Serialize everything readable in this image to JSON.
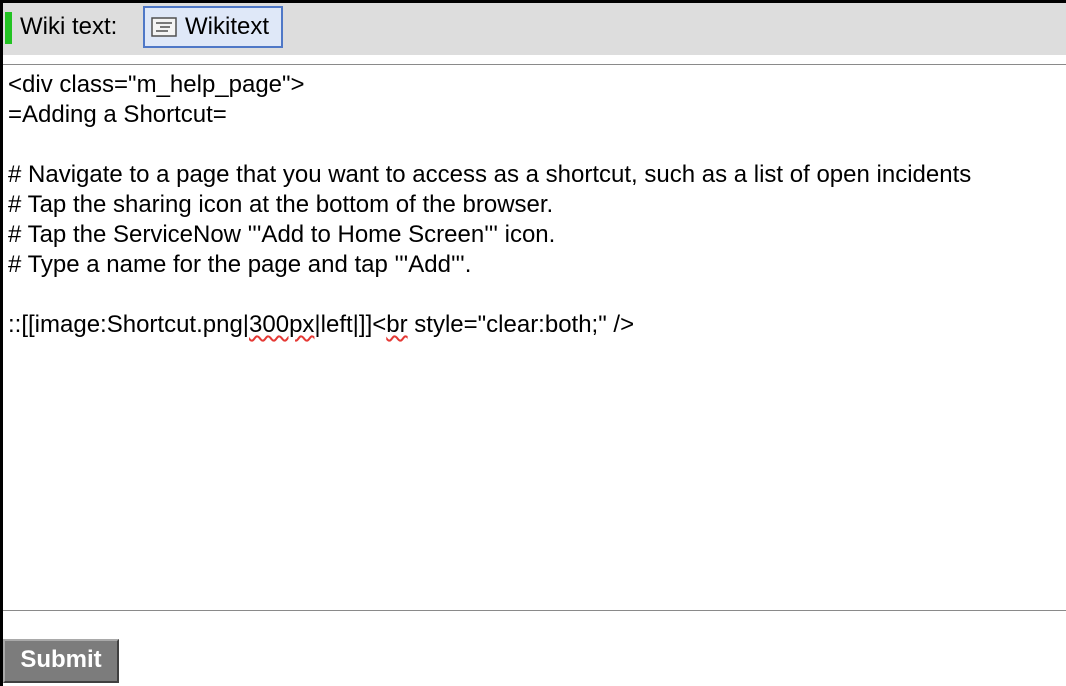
{
  "header": {
    "label": "Wiki text:",
    "format_button": {
      "label": "Wikitext",
      "icon": "wikitext-format-icon"
    }
  },
  "editor": {
    "lines": [
      "<div class=\"m_help_page\">",
      "=Adding a Shortcut=",
      "",
      "# Navigate to a page that you want to access as a shortcut, such as a list of open incidents",
      "# Tap the sharing icon at the bottom of the browser.",
      "# Tap the ServiceNow '''Add to Home Screen''' icon.",
      "# Type a name for the page and tap '''Add'''.",
      "",
      "::[[image:Shortcut.png|300px|left|]]<br style=\"clear:both;\" />"
    ],
    "line9_parts": {
      "p1": "::[[image:Shortcut.png|",
      "p2": "300px",
      "p3": "|left|]]<",
      "p4": "br",
      "p5": " style=\"clear:both;\" />"
    },
    "spellcheck_flagged": [
      "300px",
      "br"
    ]
  },
  "footer": {
    "submit_label": "Submit"
  },
  "colors": {
    "header_bg": "#dddddd",
    "required_marker": "#22c322",
    "format_button_border": "#4f78c7",
    "format_button_bg": "#dfe8f8",
    "submit_bg": "#7c7c7c",
    "spellcheck_underline": "#e53935"
  }
}
